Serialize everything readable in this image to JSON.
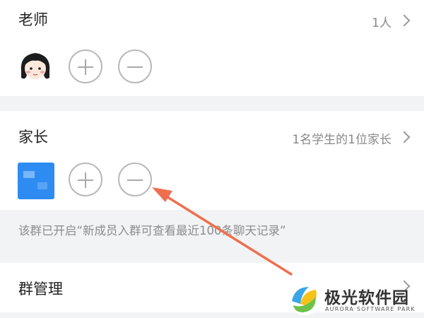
{
  "teacher_section": {
    "title": "老师",
    "count": "1人"
  },
  "parent_section": {
    "title": "家长",
    "summary": "1名学生的1位家长"
  },
  "notice": {
    "text": "该群已开启“新成员入群可查看最近100条聊天记录”"
  },
  "group_management": {
    "title": "群管理"
  },
  "watermark": {
    "name": "极光软件园",
    "subtitle": "AURORA SOFTWARE PARK"
  },
  "icons": {
    "add": "plus-circle-icon",
    "remove": "minus-circle-icon",
    "chevron": "chevron-right-icon",
    "annotation": "red-arrow"
  },
  "colors": {
    "annotation_arrow": "#ef6e4f",
    "section_gap": "#f2f3f5",
    "avatar_blue": "#2e8bf2"
  }
}
